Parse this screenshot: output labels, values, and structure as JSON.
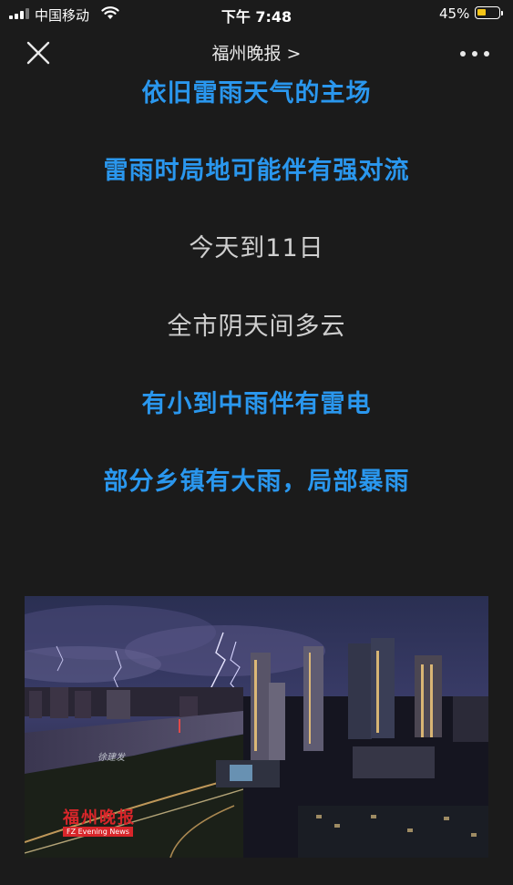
{
  "status_bar": {
    "carrier": "中国移动",
    "time": "下午 7:48",
    "battery_percent": "45%",
    "battery_level": 0.45,
    "battery_color": "#f5c518"
  },
  "nav": {
    "title": "福州晚报 >",
    "close_icon": "close-icon",
    "more_icon": "more-dots-icon"
  },
  "article": {
    "lines": [
      {
        "text": "依旧雷雨天气的主场",
        "color": "#2a97ee"
      },
      {
        "text": "雷雨时局地可能伴有强对流",
        "color": "#2a97ee"
      },
      {
        "text": "今天到11日",
        "color": "#cfcfcf"
      },
      {
        "text": "全市阴天间多云",
        "color": "#cfcfcf"
      },
      {
        "text": "有小到中雨伴有雷电",
        "color": "#2a97ee"
      },
      {
        "text": "部分乡镇有大雨，局部暴雨",
        "color": "#2a97ee"
      }
    ],
    "photo": {
      "description_icon": "city-lightning-photo",
      "logo_text": "福州晚报",
      "logo_subtext": "FZ Evening News",
      "signature": "徐建发"
    }
  }
}
